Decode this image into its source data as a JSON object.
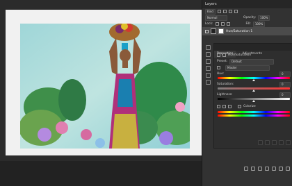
{
  "layers_panel": {
    "tab_label": "Layers",
    "kind_label": "Kind",
    "blend_mode": "Normal",
    "opacity_label": "Opacity:",
    "opacity_value": "100%",
    "lock_label": "Lock:",
    "fill_label": "Fill:",
    "fill_value": "100%",
    "layer_name": "Hue/Saturation 1"
  },
  "properties_panel": {
    "tabs": [
      "Properties",
      "Adjustments"
    ],
    "title": "Hue/Saturation",
    "preset_label": "Preset:",
    "preset_value": "Default",
    "channel_value": "Master",
    "hue_label": "Hue:",
    "hue_value": "0",
    "saturation_label": "Saturation:",
    "saturation_value": "0",
    "lightness_label": "Lightness:",
    "lightness_value": "0",
    "colorize_label": "Colorize"
  },
  "colors": {
    "panel_bg": "#323232",
    "tab_bg": "#262626",
    "selected_layer": "#4b4b4b",
    "workspace": "#2b2b2b"
  }
}
